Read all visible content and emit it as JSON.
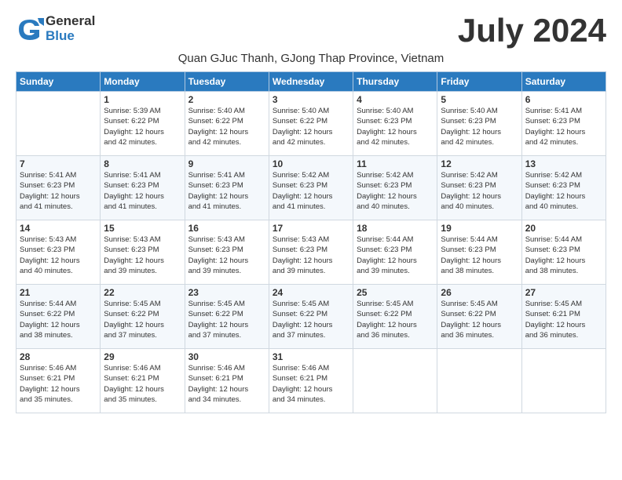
{
  "logo": {
    "general": "General",
    "blue": "Blue"
  },
  "title": "July 2024",
  "subtitle": "Quan GJuc Thanh, GJong Thap Province, Vietnam",
  "days_of_week": [
    "Sunday",
    "Monday",
    "Tuesday",
    "Wednesday",
    "Thursday",
    "Friday",
    "Saturday"
  ],
  "weeks": [
    [
      {
        "day": "",
        "info": ""
      },
      {
        "day": "1",
        "info": "Sunrise: 5:39 AM\nSunset: 6:22 PM\nDaylight: 12 hours\nand 42 minutes."
      },
      {
        "day": "2",
        "info": "Sunrise: 5:40 AM\nSunset: 6:22 PM\nDaylight: 12 hours\nand 42 minutes."
      },
      {
        "day": "3",
        "info": "Sunrise: 5:40 AM\nSunset: 6:22 PM\nDaylight: 12 hours\nand 42 minutes."
      },
      {
        "day": "4",
        "info": "Sunrise: 5:40 AM\nSunset: 6:23 PM\nDaylight: 12 hours\nand 42 minutes."
      },
      {
        "day": "5",
        "info": "Sunrise: 5:40 AM\nSunset: 6:23 PM\nDaylight: 12 hours\nand 42 minutes."
      },
      {
        "day": "6",
        "info": "Sunrise: 5:41 AM\nSunset: 6:23 PM\nDaylight: 12 hours\nand 42 minutes."
      }
    ],
    [
      {
        "day": "7",
        "info": "Sunrise: 5:41 AM\nSunset: 6:23 PM\nDaylight: 12 hours\nand 41 minutes."
      },
      {
        "day": "8",
        "info": "Sunrise: 5:41 AM\nSunset: 6:23 PM\nDaylight: 12 hours\nand 41 minutes."
      },
      {
        "day": "9",
        "info": "Sunrise: 5:41 AM\nSunset: 6:23 PM\nDaylight: 12 hours\nand 41 minutes."
      },
      {
        "day": "10",
        "info": "Sunrise: 5:42 AM\nSunset: 6:23 PM\nDaylight: 12 hours\nand 41 minutes."
      },
      {
        "day": "11",
        "info": "Sunrise: 5:42 AM\nSunset: 6:23 PM\nDaylight: 12 hours\nand 40 minutes."
      },
      {
        "day": "12",
        "info": "Sunrise: 5:42 AM\nSunset: 6:23 PM\nDaylight: 12 hours\nand 40 minutes."
      },
      {
        "day": "13",
        "info": "Sunrise: 5:42 AM\nSunset: 6:23 PM\nDaylight: 12 hours\nand 40 minutes."
      }
    ],
    [
      {
        "day": "14",
        "info": "Sunrise: 5:43 AM\nSunset: 6:23 PM\nDaylight: 12 hours\nand 40 minutes."
      },
      {
        "day": "15",
        "info": "Sunrise: 5:43 AM\nSunset: 6:23 PM\nDaylight: 12 hours\nand 39 minutes."
      },
      {
        "day": "16",
        "info": "Sunrise: 5:43 AM\nSunset: 6:23 PM\nDaylight: 12 hours\nand 39 minutes."
      },
      {
        "day": "17",
        "info": "Sunrise: 5:43 AM\nSunset: 6:23 PM\nDaylight: 12 hours\nand 39 minutes."
      },
      {
        "day": "18",
        "info": "Sunrise: 5:44 AM\nSunset: 6:23 PM\nDaylight: 12 hours\nand 39 minutes."
      },
      {
        "day": "19",
        "info": "Sunrise: 5:44 AM\nSunset: 6:23 PM\nDaylight: 12 hours\nand 38 minutes."
      },
      {
        "day": "20",
        "info": "Sunrise: 5:44 AM\nSunset: 6:23 PM\nDaylight: 12 hours\nand 38 minutes."
      }
    ],
    [
      {
        "day": "21",
        "info": "Sunrise: 5:44 AM\nSunset: 6:22 PM\nDaylight: 12 hours\nand 38 minutes."
      },
      {
        "day": "22",
        "info": "Sunrise: 5:45 AM\nSunset: 6:22 PM\nDaylight: 12 hours\nand 37 minutes."
      },
      {
        "day": "23",
        "info": "Sunrise: 5:45 AM\nSunset: 6:22 PM\nDaylight: 12 hours\nand 37 minutes."
      },
      {
        "day": "24",
        "info": "Sunrise: 5:45 AM\nSunset: 6:22 PM\nDaylight: 12 hours\nand 37 minutes."
      },
      {
        "day": "25",
        "info": "Sunrise: 5:45 AM\nSunset: 6:22 PM\nDaylight: 12 hours\nand 36 minutes."
      },
      {
        "day": "26",
        "info": "Sunrise: 5:45 AM\nSunset: 6:22 PM\nDaylight: 12 hours\nand 36 minutes."
      },
      {
        "day": "27",
        "info": "Sunrise: 5:45 AM\nSunset: 6:21 PM\nDaylight: 12 hours\nand 36 minutes."
      }
    ],
    [
      {
        "day": "28",
        "info": "Sunrise: 5:46 AM\nSunset: 6:21 PM\nDaylight: 12 hours\nand 35 minutes."
      },
      {
        "day": "29",
        "info": "Sunrise: 5:46 AM\nSunset: 6:21 PM\nDaylight: 12 hours\nand 35 minutes."
      },
      {
        "day": "30",
        "info": "Sunrise: 5:46 AM\nSunset: 6:21 PM\nDaylight: 12 hours\nand 34 minutes."
      },
      {
        "day": "31",
        "info": "Sunrise: 5:46 AM\nSunset: 6:21 PM\nDaylight: 12 hours\nand 34 minutes."
      },
      {
        "day": "",
        "info": ""
      },
      {
        "day": "",
        "info": ""
      },
      {
        "day": "",
        "info": ""
      }
    ]
  ]
}
